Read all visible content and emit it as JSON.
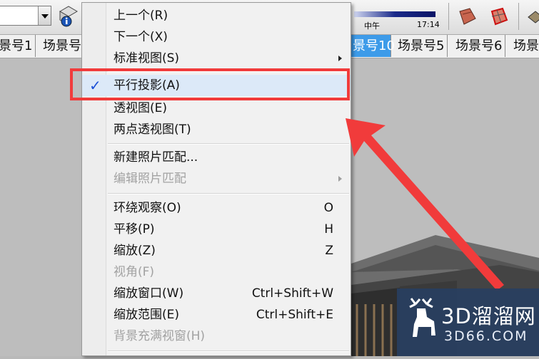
{
  "toolbar": {
    "time_labels": {
      "noon": "中午",
      "time": "17:14"
    }
  },
  "scene_tabs": [
    {
      "label": "景号1"
    },
    {
      "label": "场景号"
    },
    {
      "label": "景号10",
      "active": true
    },
    {
      "label": "场景号5"
    },
    {
      "label": "场景号6"
    },
    {
      "label": "场景"
    }
  ],
  "menu": {
    "items": [
      {
        "label": "上一个(R)"
      },
      {
        "label": "下一个(X)"
      },
      {
        "label": "标准视图(S)",
        "submenu": true
      },
      {
        "label": "平行投影(A)",
        "checked": true
      },
      {
        "label": "透视图(E)"
      },
      {
        "label": "两点透视图(T)"
      },
      {
        "label": "新建照片匹配..."
      },
      {
        "label": "编辑照片匹配",
        "disabled": true,
        "submenu": true
      },
      {
        "label": "环绕观察(O)",
        "shortcut": "O"
      },
      {
        "label": "平移(P)",
        "shortcut": "H"
      },
      {
        "label": "缩放(Z)",
        "shortcut": "Z"
      },
      {
        "label": "视角(F)",
        "disabled": true
      },
      {
        "label": "缩放窗口(W)",
        "shortcut": "Ctrl+Shift+W"
      },
      {
        "label": "缩放范围(E)",
        "shortcut": "Ctrl+Shift+E"
      },
      {
        "label": "背景充满视窗(H)",
        "disabled": true
      }
    ]
  },
  "watermark": {
    "title": "3D溜溜网",
    "subtitle": "3D66.COM"
  },
  "colors": {
    "annotation": "#f13b3b",
    "active_tab": "#3d9be9",
    "check": "#1a4fd6"
  }
}
